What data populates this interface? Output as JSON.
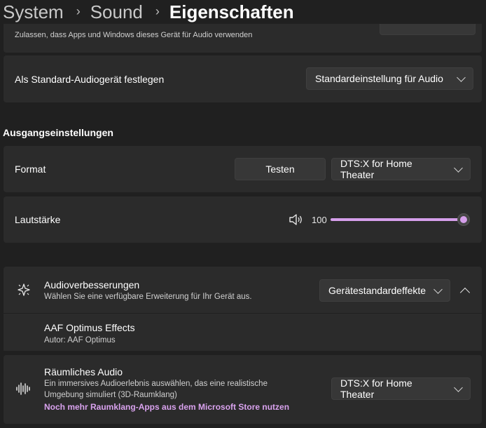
{
  "breadcrumb": {
    "items": [
      "System",
      "Sound",
      "Eigenschaften"
    ]
  },
  "allow_apps": {
    "text": "Zulassen, dass Apps und Windows dieses Gerät für Audio verwenden"
  },
  "default_device": {
    "label": "Als Standard-Audiogerät festlegen",
    "value": "Standardeinstellung für Audio"
  },
  "output": {
    "section_title": "Ausgangseinstellungen",
    "format": {
      "label": "Format",
      "test_label": "Testen",
      "value": "DTS:X for Home Theater"
    },
    "volume": {
      "label": "Lautstärke",
      "value": "100",
      "level_percent": 100
    }
  },
  "enhancements": {
    "title": "Audioverbesserungen",
    "description": "Wählen Sie eine verfügbare Erweiterung für Ihr Gerät aus.",
    "value": "Gerätestandardeffekte",
    "effect": {
      "title": "AAF Optimus Effects",
      "author": "Autor: AAF Optimus"
    }
  },
  "spatial": {
    "title": "Räumliches Audio",
    "description_line1": "Ein immersives Audioerlebnis auswählen, das eine realistische",
    "description_line2": "Umgebung simuliert (3D-Raumklang)",
    "link": "Noch mehr Raumklang-Apps aus dem Microsoft Store nutzen",
    "value": "DTS:X for Home Theater"
  },
  "colors": {
    "accent": "#d59fea",
    "background": "#202020",
    "card": "#2b2b2b",
    "control": "#373737"
  },
  "icons": {
    "speaker": "speaker-icon",
    "enhancement": "sparkle-icon",
    "spatial": "waveform-icon",
    "chevron": "chevron-down-icon"
  }
}
